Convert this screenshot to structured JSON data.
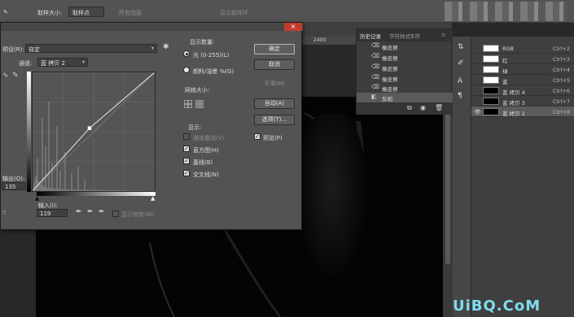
{
  "options_bar": {
    "sample_size_label": "取样大小:",
    "sample_size_value": "取样点",
    "sample_all_layers_label": "所有图层",
    "show_ring_label": "显示取样环"
  },
  "ruler": {
    "tick_label": "2400"
  },
  "history": {
    "tabs": [
      "历史记录",
      "字符样式",
      "字符"
    ],
    "items": [
      {
        "icon": "eraser-icon",
        "label": "橡皮擦"
      },
      {
        "icon": "eraser-icon",
        "label": "橡皮擦"
      },
      {
        "icon": "eraser-icon",
        "label": "橡皮擦"
      },
      {
        "icon": "eraser-icon",
        "label": "橡皮擦"
      },
      {
        "icon": "eraser-icon",
        "label": "橡皮擦"
      },
      {
        "icon": "invert-icon",
        "label": "反相",
        "selected": true
      }
    ]
  },
  "channels": {
    "rows": [
      {
        "name": "RGB",
        "shortcut": "Ctrl+2",
        "thumb_color": "#ffffff"
      },
      {
        "name": "红",
        "shortcut": "Ctrl+3",
        "thumb_color": "#ffffff"
      },
      {
        "name": "绿",
        "shortcut": "Ctrl+4",
        "thumb_color": "#ffffff"
      },
      {
        "name": "蓝",
        "shortcut": "Ctrl+5",
        "thumb_color": "#ffffff"
      },
      {
        "name": "蓝 拷贝 4",
        "shortcut": "Ctrl+6",
        "thumb_color": "#000000"
      },
      {
        "name": "蓝 拷贝 3",
        "shortcut": "Ctrl+7",
        "thumb_color": "#000000"
      },
      {
        "name": "蓝 拷贝 2",
        "shortcut": "Ctrl+8",
        "thumb_color": "#000000",
        "selected": true,
        "visible": true
      }
    ]
  },
  "curves": {
    "preset_label": "预设(R):",
    "preset_value": "自定",
    "channel_label": "通道:",
    "channel_value": "蓝 拷贝 2",
    "output_label": "输出(O):",
    "output_value": "135",
    "input_label": "输入(I):",
    "input_value": "119",
    "show_clipping_label": "显示修剪(W)",
    "show_amount": {
      "heading": "显示数量:",
      "light_label": "光 (0-255)(L)",
      "pigment_label": "颜料/油墨 %(G)"
    },
    "grid_size_heading": "网格大小:",
    "display": {
      "heading": "显示:",
      "channel_overlay_label": "通道叠加(V)",
      "histogram_label": "直方图(H)",
      "baseline_label": "基线(B)",
      "intersection_label": "交叉线(N)"
    },
    "buttons": {
      "ok": "确定",
      "cancel": "取消",
      "smooth": "平滑(M)",
      "auto": "自动(A)",
      "options": "选项(T)..."
    },
    "preview_label": "预览(P)",
    "curve_points": [
      [
        0,
        0
      ],
      [
        119,
        135
      ],
      [
        255,
        255
      ]
    ]
  },
  "watermark": "UiBQ.CoM"
}
